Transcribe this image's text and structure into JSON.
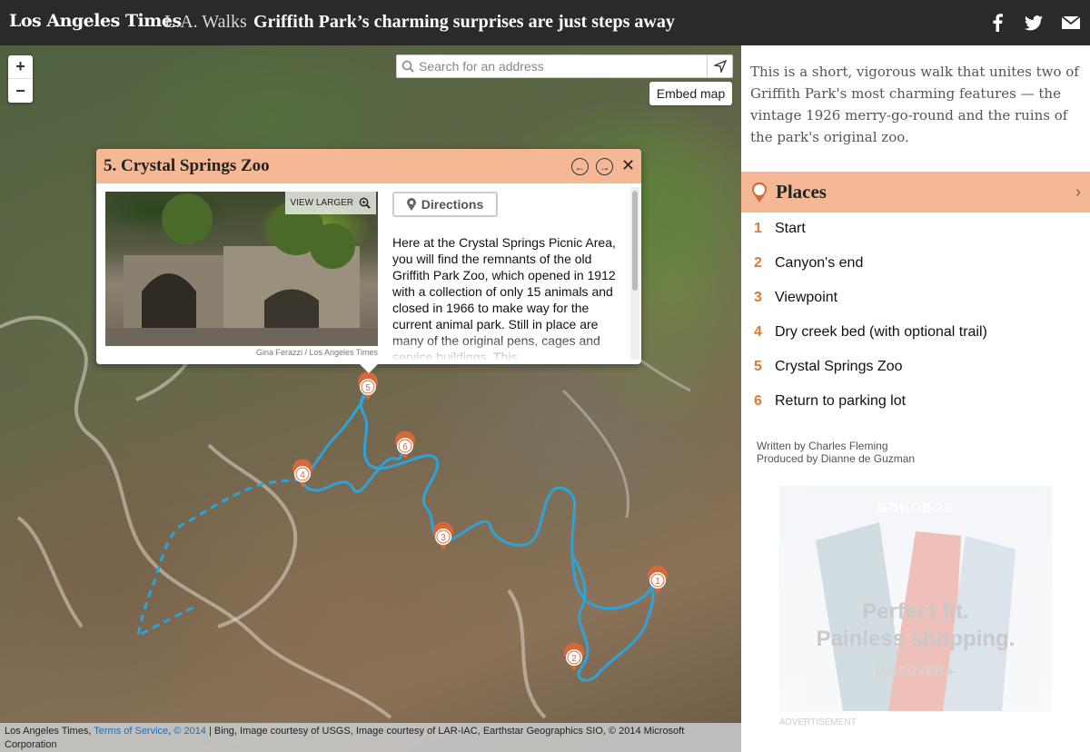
{
  "header": {
    "logo": "Los Angeles Times",
    "section": "L.A. Walks",
    "headline": "Griffith Park’s charming surprises are just steps away",
    "share": [
      "facebook-icon",
      "twitter-icon",
      "mail-icon"
    ]
  },
  "map": {
    "zoom_in": "+",
    "zoom_out": "−",
    "search_placeholder": "Search for an address",
    "embed": "Embed map",
    "attribution": {
      "prefix": "Los Angeles Times,",
      "tos": "Terms of Service",
      "year": "© 2014",
      "suffix": "| Bing, Image courtesy of USGS, Image courtesy of LAR-IAC, Earthstar Geographics SIO, © 2014 Microsoft Corporation"
    },
    "markers": [
      "1",
      "2",
      "3",
      "4",
      "5",
      "6"
    ]
  },
  "popup": {
    "title": "5. Crystal Springs Zoo",
    "view_larger": "VIEW LARGER",
    "credit": "Gina Ferazzi / Los Angeles Times",
    "directions": "Directions",
    "description": "Here at the Crystal Springs Picnic Area, you will find the remnants of the old Griffith Park Zoo, which opened in 1912 with a collection of only 15 animals and closed in 1966 to make way for the current animal park. Still in place are many of the original pens, cages and service buildings. This"
  },
  "sidebar": {
    "intro": "This is a short, vigorous walk that unites two of Griffith Park's most charming features — the vintage 1926 merry-go-round and the ruins of the park's original zoo.",
    "places_title": "Places",
    "places": [
      {
        "num": "1",
        "label": "Start"
      },
      {
        "num": "2",
        "label": "Canyon's end"
      },
      {
        "num": "3",
        "label": "Viewpoint"
      },
      {
        "num": "4",
        "label": "Dry creek bed (with optional trail)"
      },
      {
        "num": "5",
        "label": "Crystal Springs Zoo"
      },
      {
        "num": "6",
        "label": "Return to parking lot"
      }
    ],
    "written_by": "Written by Charles Fleming",
    "produced_by": "Produced by Dianne de Guzman",
    "ad": {
      "brand": "BONOBOS",
      "line1": "Perfect fit.",
      "line2": "Painless shopping.",
      "cta": "DISCOVER ▸",
      "label": "ADVERTISEMENT"
    }
  },
  "colors": {
    "accent": "#f4b895",
    "marker": "#e07a4a",
    "route": "#2b9fd6",
    "header_bg": "#2a2a2a"
  }
}
